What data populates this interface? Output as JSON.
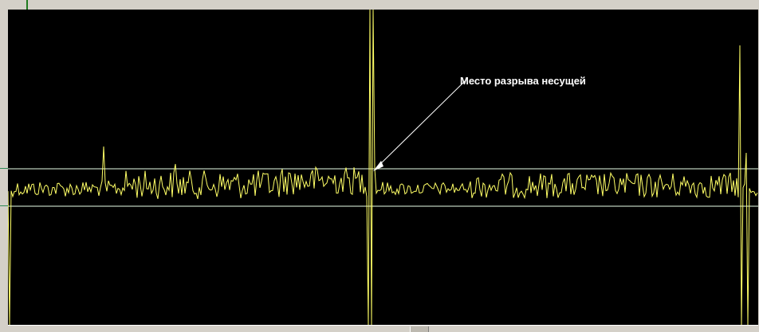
{
  "annotation": {
    "label": "Место разрыва несущей"
  },
  "colors": {
    "background": "#000000",
    "trace": "#ffff66",
    "marker_lines": "#e8ffe8",
    "annotation_text": "#ffffff",
    "frame": "#d4d0c8"
  },
  "scope": {
    "trace_description_hidden": "",
    "marker_lines_count": 2
  }
}
